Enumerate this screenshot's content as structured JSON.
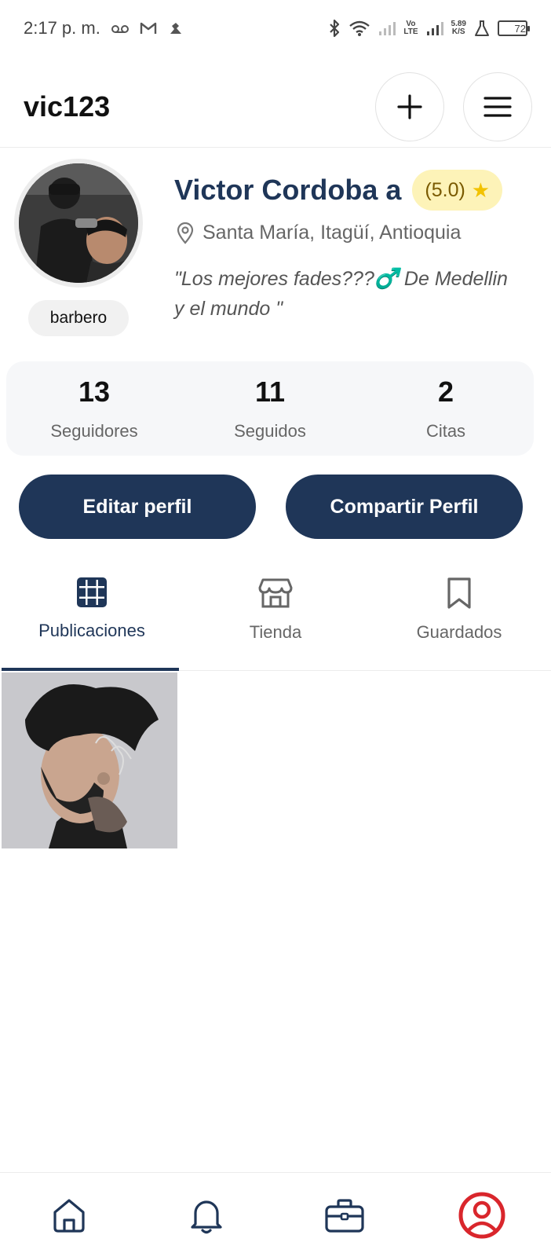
{
  "status_bar": {
    "time": "2:17 p. m.",
    "network_speed_value": "5.89",
    "network_speed_unit": "K/S",
    "volte_top": "Vo",
    "volte_bottom": "LTE",
    "battery": "72"
  },
  "header": {
    "username": "vic123",
    "add_icon": "plus-icon",
    "menu_icon": "hamburger-menu-icon"
  },
  "profile": {
    "display_name": "Victor Cordoba a",
    "rating": "(5.0)",
    "rating_star": "★",
    "location": "Santa María, Itagüí, Antioquia",
    "bio": "\"Los mejores fades???♂️ De Medellin y el mundo \"",
    "role": "barbero"
  },
  "stats": [
    {
      "value": "13",
      "label": "Seguidores"
    },
    {
      "value": "11",
      "label": "Seguidos"
    },
    {
      "value": "2",
      "label": "Citas"
    }
  ],
  "actions": {
    "edit": "Editar perfil",
    "share": "Compartir Perfil"
  },
  "tabs": [
    {
      "label": "Publicaciones",
      "icon": "grid-icon",
      "active": true
    },
    {
      "label": "Tienda",
      "icon": "store-icon",
      "active": false
    },
    {
      "label": "Guardados",
      "icon": "bookmark-icon",
      "active": false
    }
  ],
  "bottom_nav": [
    {
      "icon": "home-icon"
    },
    {
      "icon": "bell-icon"
    },
    {
      "icon": "briefcase-icon"
    },
    {
      "icon": "profile-icon",
      "active": true
    }
  ],
  "colors": {
    "brand": "#1f3658",
    "rating_bg": "#fdf3b8",
    "star": "#f2c200",
    "active_profile": "#d9262c"
  }
}
